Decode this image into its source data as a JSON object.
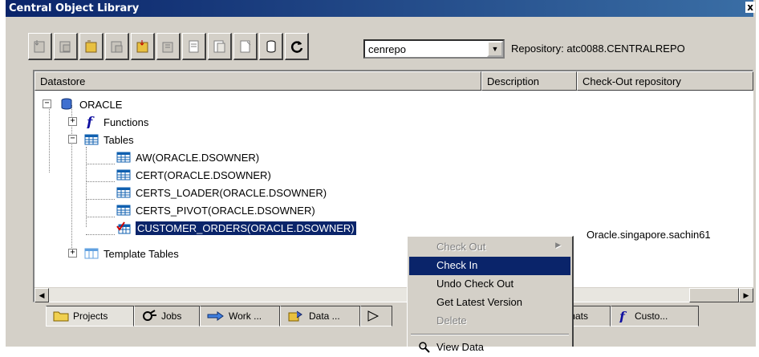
{
  "window": {
    "title": "Central Object Library",
    "close_glyph": "x"
  },
  "toolbar": {
    "buttons": [
      {
        "icon": "get-latest-icon"
      },
      {
        "icon": "get-latest-with-deps-icon"
      },
      {
        "icon": "check-out-icon"
      },
      {
        "icon": "check-out-with-deps-icon"
      },
      {
        "icon": "check-out-no-replace-icon"
      },
      {
        "icon": "check-out-no-replace-deps-icon"
      },
      {
        "icon": "check-in-icon"
      },
      {
        "icon": "check-in-deps-icon"
      },
      {
        "icon": "undo-check-out-icon"
      },
      {
        "icon": "repository-icon"
      },
      {
        "icon": "refresh-icon"
      }
    ]
  },
  "repository": {
    "selected": "cenrepo",
    "label": "Repository: atc0088.CENTRALREPO"
  },
  "columns": [
    "Datastore",
    "Description",
    "Check-Out repository"
  ],
  "tree": {
    "root": "ORACLE",
    "functions": "Functions",
    "tables": "Tables",
    "table_items": [
      "AW(ORACLE.DSOWNER)",
      "CERT(ORACLE.DSOWNER)",
      "CERTS_LOADER(ORACLE.DSOWNER)",
      "CERTS_PIVOT(ORACLE.DSOWNER)",
      "CUSTOMER_ORDERS(ORACLE.DSOWNER)"
    ],
    "template_tables": "Template Tables",
    "checkout_repo": "Oracle.singapore.sachin61"
  },
  "tabs": [
    {
      "label": "Projects",
      "icon": "folder-icon"
    },
    {
      "label": "Jobs",
      "icon": "jobs-icon"
    },
    {
      "label": "Work ...",
      "icon": "workflow-icon"
    },
    {
      "label": "Data ...",
      "icon": "dataflow-icon"
    },
    {
      "label": "",
      "icon": "transforms-icon"
    },
    {
      "label": "Formats",
      "icon": "formats-icon"
    },
    {
      "label": "Custo...",
      "icon": "custom-functions-icon"
    }
  ],
  "context_menu": {
    "items": [
      {
        "label": "Check Out",
        "state": "disabled",
        "submenu": true
      },
      {
        "label": "Check In",
        "state": "highlighted"
      },
      {
        "label": "Undo Check Out",
        "state": "normal"
      },
      {
        "label": "Get Latest Version",
        "state": "normal"
      },
      {
        "label": "Delete",
        "state": "disabled"
      },
      {
        "label": "View Data",
        "state": "normal",
        "icon": "magnifier-icon"
      }
    ]
  },
  "colors": {
    "title_start": "#0a246a",
    "title_end": "#3a6ea5",
    "selection": "#0a246a",
    "face": "#d4d0c8"
  }
}
